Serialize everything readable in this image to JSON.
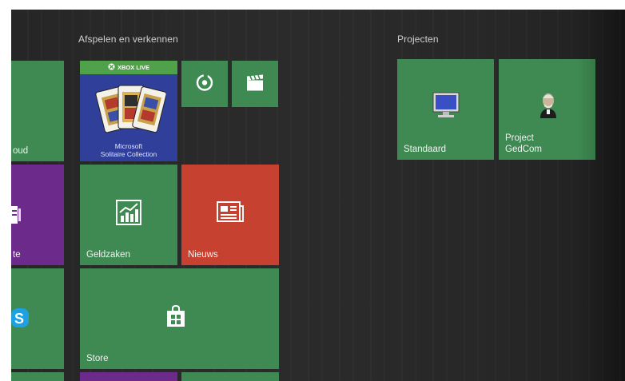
{
  "groups": {
    "play": {
      "header": "Afspelen en verkennen"
    },
    "projects": {
      "header": "Projecten"
    }
  },
  "tiles": {
    "cloud_partial": {
      "label": "oud"
    },
    "onenote_partial": {
      "label": "te"
    },
    "skype_partial": {
      "icon": "skype-icon"
    },
    "solitaire": {
      "badge": "XBOX LIVE",
      "line1": "Microsoft",
      "line2": "Solitaire Collection"
    },
    "groove": {
      "icon": "groove-music-icon"
    },
    "movies": {
      "icon": "clapperboard-icon"
    },
    "geldzaken": {
      "label": "Geldzaken",
      "icon": "chart-icon"
    },
    "nieuws": {
      "label": "Nieuws",
      "icon": "news-icon"
    },
    "store": {
      "label": "Store",
      "icon": "shopping-bag-icon"
    },
    "standaard": {
      "label": "Standaard",
      "icon": "monitor-icon"
    },
    "gedcom": {
      "line1": "Project",
      "line2": "GedCom",
      "icon": "portrait-icon"
    }
  },
  "colors": {
    "background": "#262626",
    "tile_green": "#3e8a52",
    "tile_purple": "#6c2a8a",
    "tile_red": "#c6412f",
    "solitaire_blue": "#2f3f9a",
    "xbox_green": "#4fa24a"
  }
}
